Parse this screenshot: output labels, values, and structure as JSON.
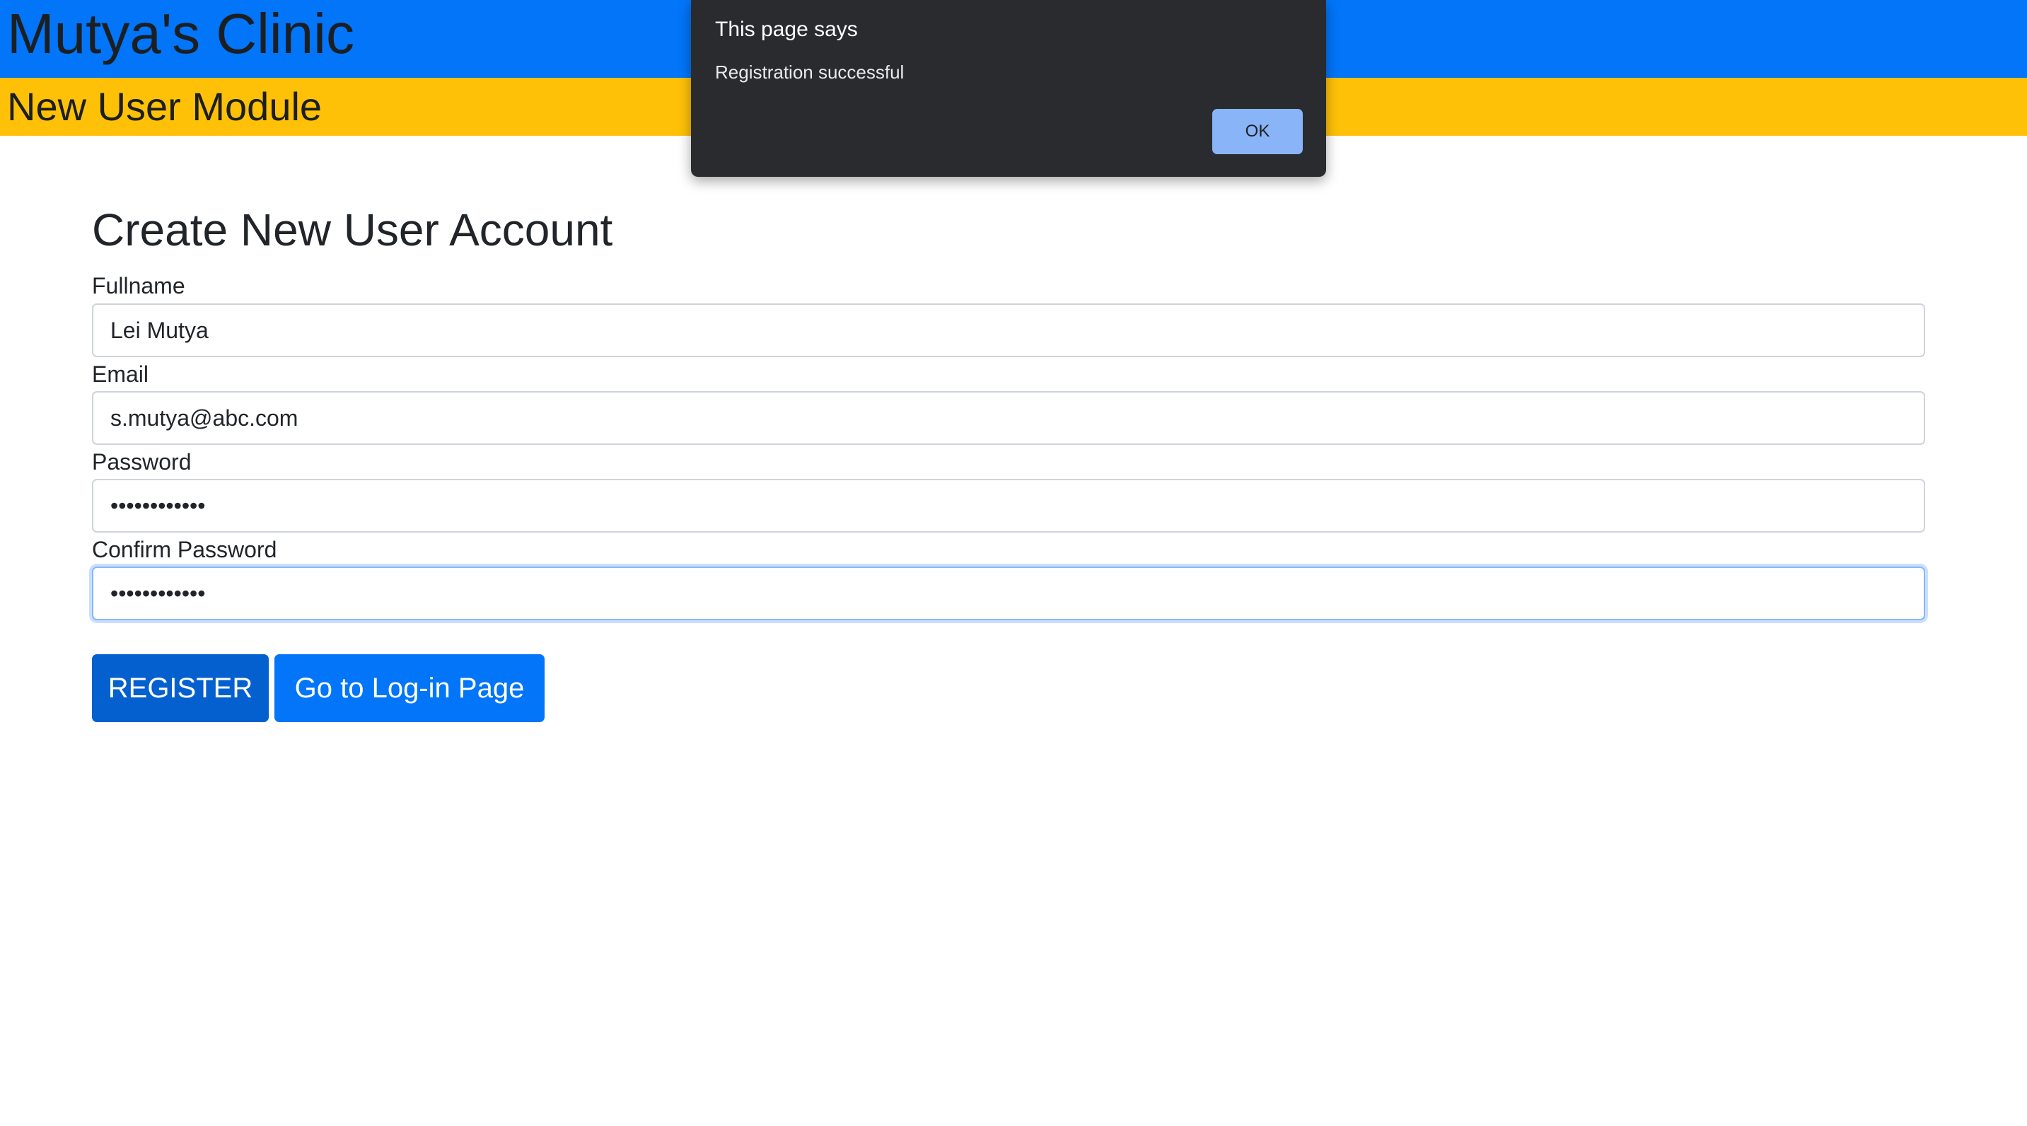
{
  "header": {
    "app_title": "Mutya's Clinic",
    "module_title": "New User Module"
  },
  "form": {
    "title": "Create New User Account",
    "fields": [
      {
        "label": "Fullname",
        "value": "Lei Mutya",
        "type": "text"
      },
      {
        "label": "Email",
        "value": "s.mutya@abc.com",
        "type": "text"
      },
      {
        "label": "Password",
        "value": "••••••••••••",
        "type": "password"
      },
      {
        "label": "Confirm Password",
        "value": "••••••••••••",
        "type": "password"
      }
    ],
    "register_label": "REGISTER",
    "login_label": "Go to Log-in Page"
  },
  "dialog": {
    "title": "This page says",
    "message": "Registration successful",
    "ok_label": "OK"
  },
  "colors": {
    "primary_blue": "#0275f8",
    "register_blue": "#0560cf",
    "module_yellow": "#ffc107",
    "dialog_background": "#2a2b2f",
    "dialog_button": "#8ab4f8"
  }
}
